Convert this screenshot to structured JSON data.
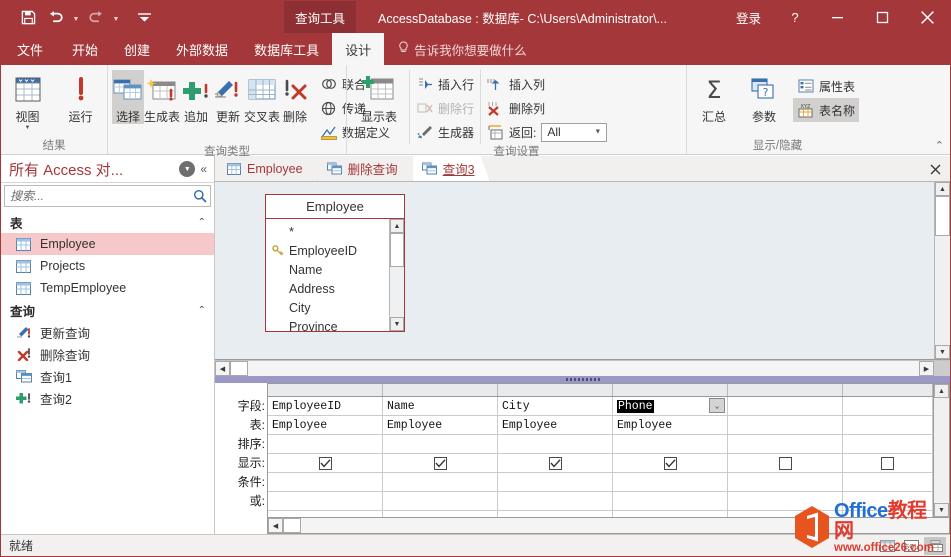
{
  "window": {
    "app_title": "AccessDatabase : 数据库- C:\\Users\\Administrator\\...",
    "contextual_tab": "查询工具",
    "sign_in": "登录",
    "help": "?",
    "minimize_icon": "minimize-icon",
    "maximize_icon": "maximize-icon",
    "close_icon": "close-icon"
  },
  "qat": {
    "save": "save-icon",
    "undo": "undo-icon",
    "redo": "redo-icon",
    "customize": "customize-qat-icon"
  },
  "ribbon_tabs": [
    {
      "label": "文件",
      "active": false
    },
    {
      "label": "开始",
      "active": false
    },
    {
      "label": "创建",
      "active": false
    },
    {
      "label": "外部数据",
      "active": false
    },
    {
      "label": "数据库工具",
      "active": false
    },
    {
      "label": "设计",
      "active": true
    }
  ],
  "tell_me": "告诉我你想要做什么",
  "ribbon": {
    "groups": [
      {
        "label": "结果",
        "big_buttons": [
          {
            "label": "视图",
            "icon": "view-table-icon",
            "dropdown": true,
            "selected": false
          },
          {
            "label": "运行",
            "icon": "run-exclamation-icon",
            "dropdown": false,
            "selected": false
          }
        ]
      },
      {
        "label": "查询类型",
        "big_buttons": [
          {
            "label": "选择",
            "icon": "select-query-icon",
            "dropdown": false,
            "selected": true
          },
          {
            "label": "生成表",
            "icon": "make-table-query-icon",
            "dropdown": false,
            "selected": false
          },
          {
            "label": "追加",
            "icon": "append-query-icon",
            "dropdown": false,
            "selected": false
          },
          {
            "label": "更新",
            "icon": "update-query-icon",
            "dropdown": false,
            "selected": false
          },
          {
            "label": "交叉表",
            "icon": "crosstab-query-icon",
            "dropdown": false,
            "selected": false
          },
          {
            "label": "删除",
            "icon": "delete-query-icon",
            "dropdown": false,
            "selected": false
          }
        ],
        "small_buttons": [
          {
            "label": "联合",
            "icon": "union-query-icon"
          },
          {
            "label": "传递",
            "icon": "pass-through-query-icon"
          },
          {
            "label": "数据定义",
            "icon": "data-definition-query-icon"
          }
        ]
      },
      {
        "label": "查询设置",
        "big_buttons": [
          {
            "label": "显示表",
            "icon": "show-table-icon",
            "dropdown": false,
            "selected": false
          }
        ],
        "small_col_1": [
          {
            "label": "插入行",
            "icon": "insert-row-icon",
            "disabled": false
          },
          {
            "label": "删除行",
            "icon": "delete-row-icon",
            "disabled": true
          },
          {
            "label": "生成器",
            "icon": "builder-icon",
            "disabled": false
          }
        ],
        "small_col_2": [
          {
            "label": "插入列",
            "icon": "insert-column-icon",
            "disabled": false
          },
          {
            "label": "删除列",
            "icon": "delete-column-icon",
            "disabled": false
          }
        ],
        "return": {
          "label": "返回:",
          "icon": "return-rows-icon",
          "value": "All"
        }
      },
      {
        "label": "显示/隐藏",
        "big_buttons": [
          {
            "label": "汇总",
            "icon": "totals-sigma-icon",
            "dropdown": false,
            "selected": false
          },
          {
            "label": "参数",
            "icon": "parameters-icon",
            "dropdown": false,
            "selected": false
          }
        ],
        "small_buttons": [
          {
            "label": "属性表",
            "icon": "property-sheet-icon",
            "selected": false
          },
          {
            "label": "表名称",
            "icon": "table-names-icon",
            "selected": true
          }
        ]
      }
    ],
    "collapse_icon": "collapse-ribbon-icon"
  },
  "nav_pane": {
    "title": "所有 Access 对...",
    "dropdown_icon": "chevron-down-circle-icon",
    "collapse_icon": "double-chevron-left-icon",
    "search_placeholder": "搜索...",
    "search_value": "",
    "search_icon": "search-icon",
    "sections": [
      {
        "label": "表",
        "chevron": "collapse-chevron-icon",
        "items": [
          {
            "label": "Employee",
            "icon": "table-icon",
            "selected": true
          },
          {
            "label": "Projects",
            "icon": "table-icon",
            "selected": false
          },
          {
            "label": "TempEmployee",
            "icon": "table-icon",
            "selected": false
          }
        ]
      },
      {
        "label": "查询",
        "chevron": "collapse-chevron-icon",
        "items": [
          {
            "label": "更新查询",
            "icon": "update-query-icon",
            "selected": false
          },
          {
            "label": "删除查询",
            "icon": "delete-query-icon",
            "selected": false
          },
          {
            "label": "查询1",
            "icon": "select-query-icon",
            "selected": false
          },
          {
            "label": "查询2",
            "icon": "append-query-icon",
            "selected": false
          }
        ]
      }
    ]
  },
  "doc_tabs": [
    {
      "label": "Employee",
      "icon": "table-icon",
      "active": false
    },
    {
      "label": "删除查询",
      "icon": "query-icon",
      "active": false
    },
    {
      "label": "查询3",
      "icon": "query-icon",
      "active": true
    }
  ],
  "doc_close_icon": "close-icon",
  "design_pane": {
    "table_box": {
      "title": "Employee",
      "fields": [
        {
          "name": "*",
          "key": false
        },
        {
          "name": "EmployeeID",
          "key": true
        },
        {
          "name": "Name",
          "key": false
        },
        {
          "name": "Address",
          "key": false
        },
        {
          "name": "City",
          "key": false
        },
        {
          "name": "Province",
          "key": false
        }
      ]
    }
  },
  "query_grid": {
    "row_labels": [
      "字段:",
      "表:",
      "排序:",
      "显示:",
      "条件:",
      "或:"
    ],
    "columns": [
      {
        "field": "EmployeeID",
        "table": "Employee",
        "sort": "",
        "show": true,
        "criteria": "",
        "or": "",
        "active": false
      },
      {
        "field": "Name",
        "table": "Employee",
        "sort": "",
        "show": true,
        "criteria": "",
        "or": "",
        "active": false
      },
      {
        "field": "City",
        "table": "Employee",
        "sort": "",
        "show": true,
        "criteria": "",
        "or": "",
        "active": false
      },
      {
        "field": "Phone",
        "table": "Employee",
        "sort": "",
        "show": true,
        "criteria": "",
        "or": "",
        "active": true
      },
      {
        "field": "",
        "table": "",
        "sort": "",
        "show": false,
        "criteria": "",
        "or": "",
        "active": false
      },
      {
        "field": "",
        "table": "",
        "sort": "",
        "show": false,
        "criteria": "",
        "or": "",
        "active": false
      }
    ]
  },
  "status_bar": {
    "text": "就绪",
    "view_buttons": [
      {
        "icon": "datasheet-view-icon",
        "active": false
      },
      {
        "icon": "sql-view-icon",
        "active": false
      },
      {
        "icon": "design-view-icon",
        "active": true
      }
    ]
  },
  "watermark": {
    "line1_en": "Office",
    "line1_cn": "教程网",
    "line2": "www.office26.com",
    "logo_icon": "office-logo-icon"
  },
  "colors": {
    "accent": "#a4373a",
    "contextual_tab": "#8e2f33",
    "ribbon_bg": "#f7f6f6",
    "nav_selected": "#f7c8ca",
    "design_pane_bg": "#e8edf2",
    "splitter": "#9a98c6"
  }
}
